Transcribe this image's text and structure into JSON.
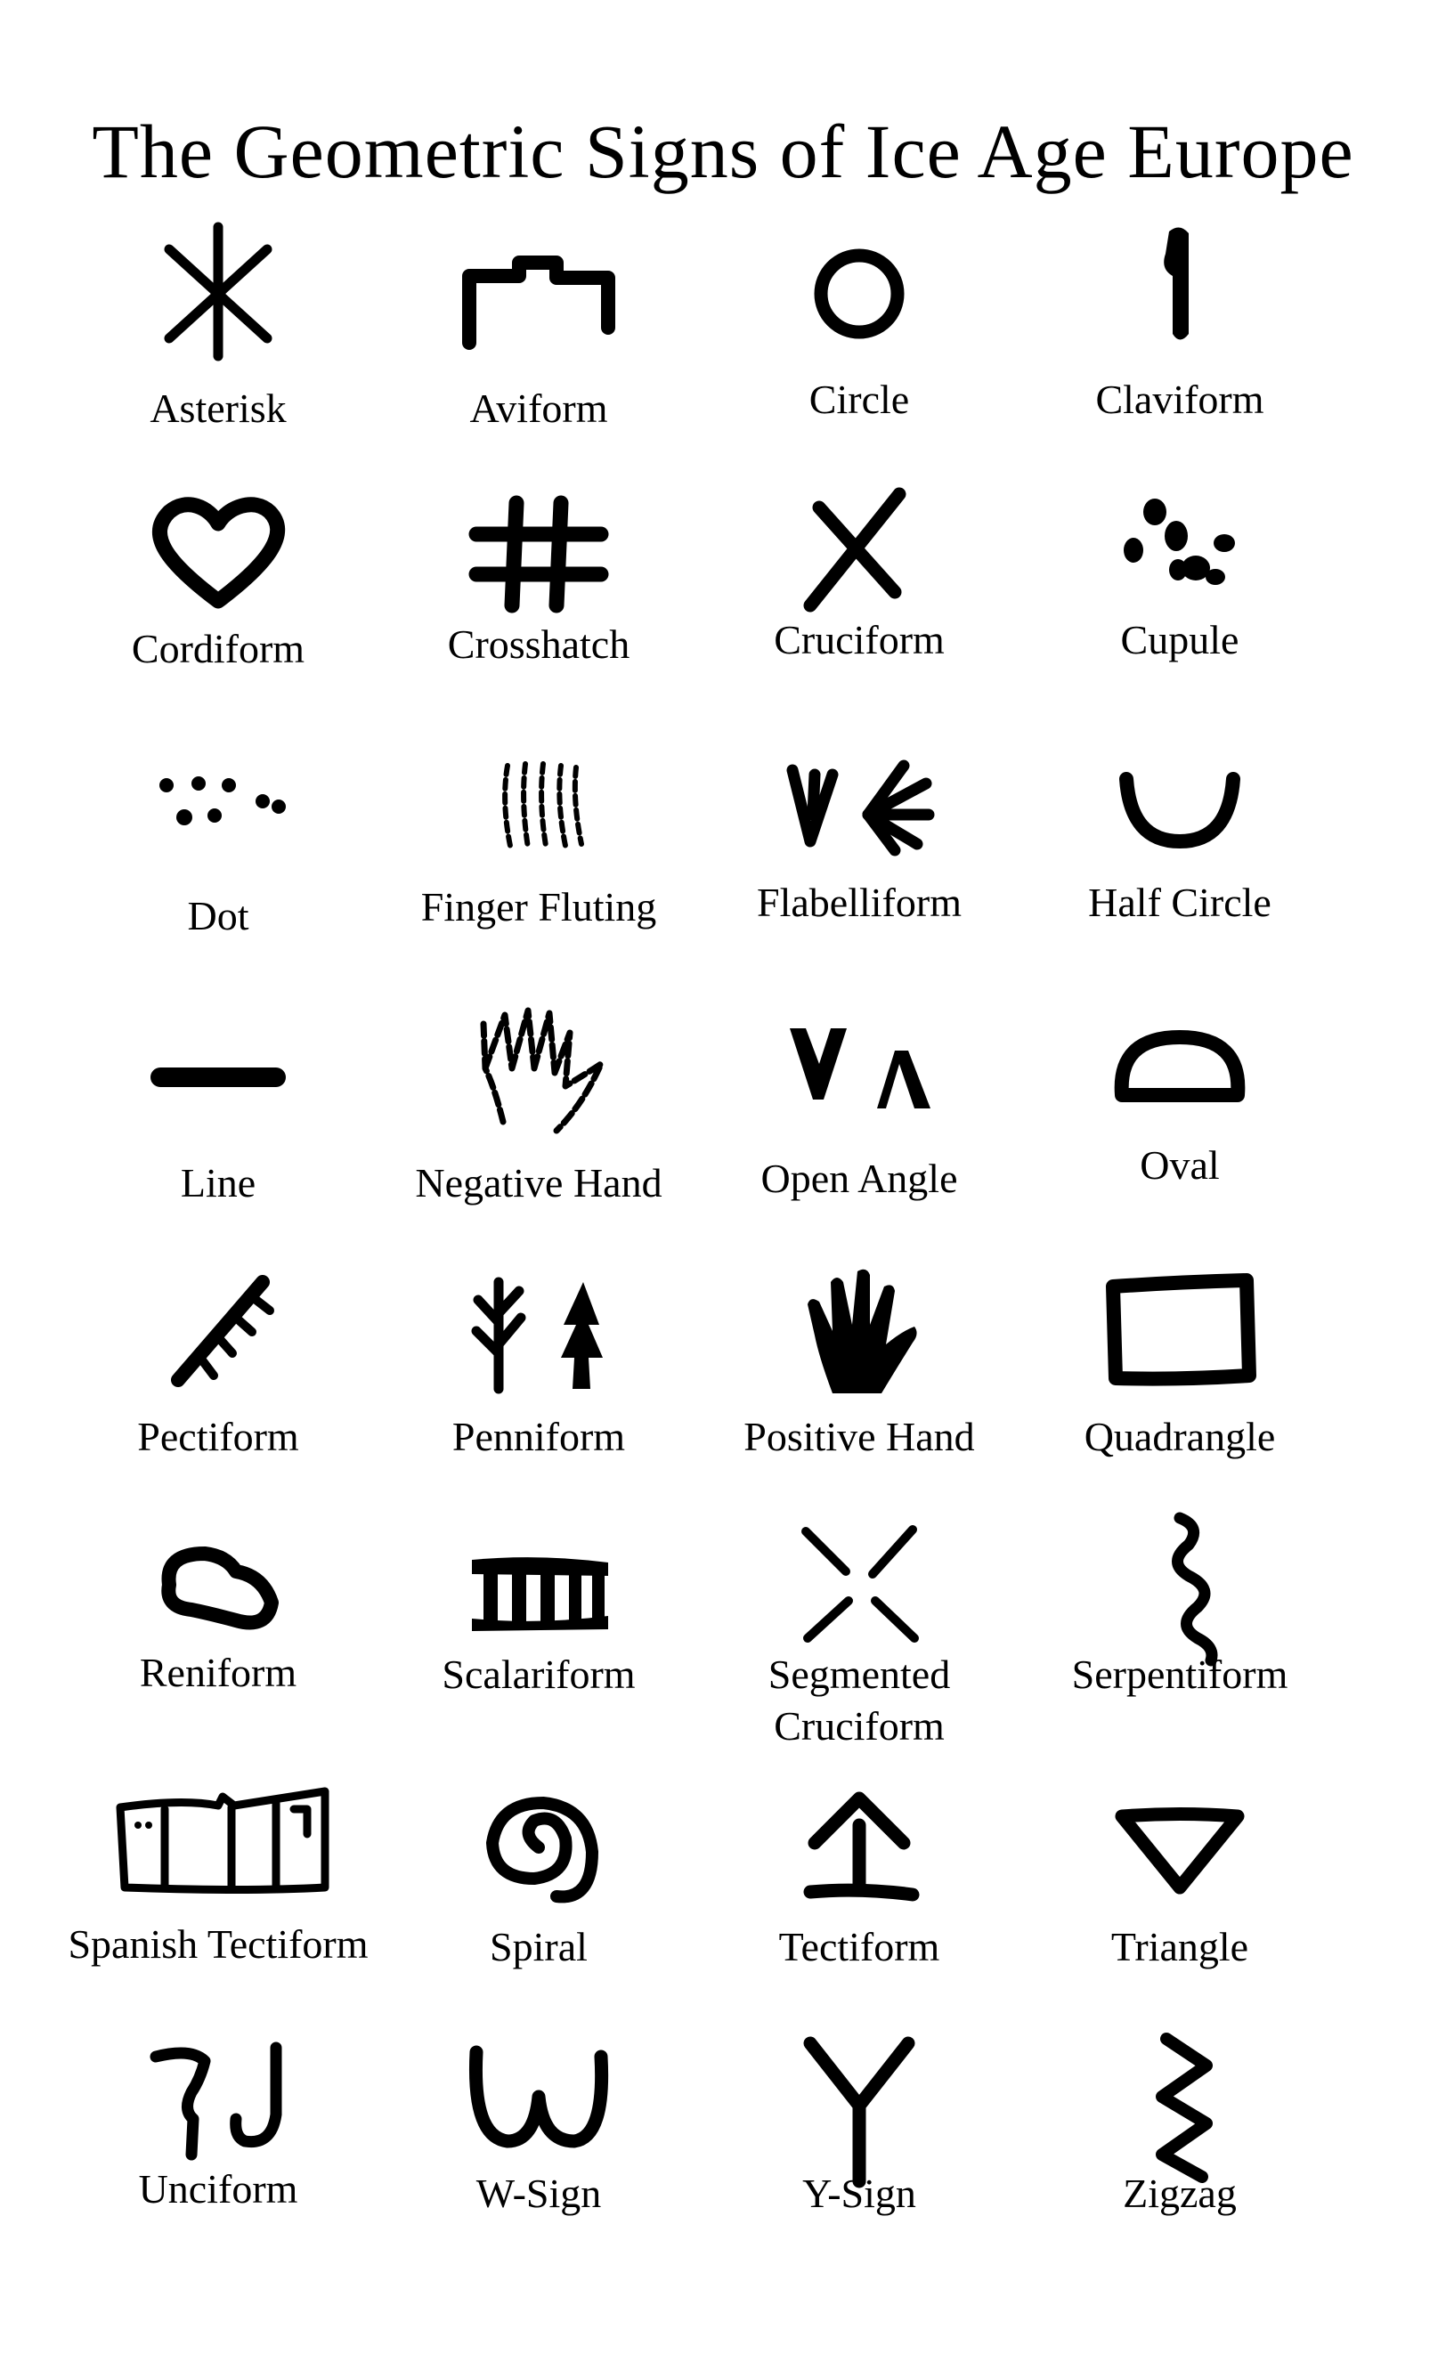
{
  "title": "The Geometric Signs of Ice Age Europe",
  "signs": [
    {
      "label": "Asterisk",
      "icon": "asterisk-icon"
    },
    {
      "label": "Aviform",
      "icon": "aviform-icon"
    },
    {
      "label": "Circle",
      "icon": "circle-icon"
    },
    {
      "label": "Claviform",
      "icon": "claviform-icon"
    },
    {
      "label": "Cordiform",
      "icon": "cordiform-icon"
    },
    {
      "label": "Crosshatch",
      "icon": "crosshatch-icon"
    },
    {
      "label": "Cruciform",
      "icon": "cruciform-icon"
    },
    {
      "label": "Cupule",
      "icon": "cupule-icon"
    },
    {
      "label": "Dot",
      "icon": "dot-icon"
    },
    {
      "label": "Finger Fluting",
      "icon": "finger-fluting-icon"
    },
    {
      "label": "Flabelliform",
      "icon": "flabelliform-icon"
    },
    {
      "label": "Half Circle",
      "icon": "half-circle-icon"
    },
    {
      "label": "Line",
      "icon": "line-icon"
    },
    {
      "label": "Negative Hand",
      "icon": "negative-hand-icon"
    },
    {
      "label": "Open Angle",
      "icon": "open-angle-icon"
    },
    {
      "label": "Oval",
      "icon": "oval-icon"
    },
    {
      "label": "Pectiform",
      "icon": "pectiform-icon"
    },
    {
      "label": "Penniform",
      "icon": "penniform-icon"
    },
    {
      "label": "Positive Hand",
      "icon": "positive-hand-icon"
    },
    {
      "label": "Quadrangle",
      "icon": "quadrangle-icon"
    },
    {
      "label": "Reniform",
      "icon": "reniform-icon"
    },
    {
      "label": "Scalariform",
      "icon": "scalariform-icon"
    },
    {
      "label_lines": [
        "Segmented",
        "Cruciform"
      ],
      "icon": "segmented-cruciform-icon"
    },
    {
      "label": "Serpentiform",
      "icon": "serpentiform-icon"
    },
    {
      "label": "Spanish Tectiform",
      "icon": "spanish-tectiform-icon"
    },
    {
      "label": "Spiral",
      "icon": "spiral-icon"
    },
    {
      "label": "Tectiform",
      "icon": "tectiform-icon"
    },
    {
      "label": "Triangle",
      "icon": "triangle-icon"
    },
    {
      "label": "Unciform",
      "icon": "unciform-icon"
    },
    {
      "label": "W-Sign",
      "icon": "w-sign-icon"
    },
    {
      "label": "Y-Sign",
      "icon": "y-sign-icon"
    },
    {
      "label": "Zigzag",
      "icon": "zigzag-icon"
    }
  ]
}
